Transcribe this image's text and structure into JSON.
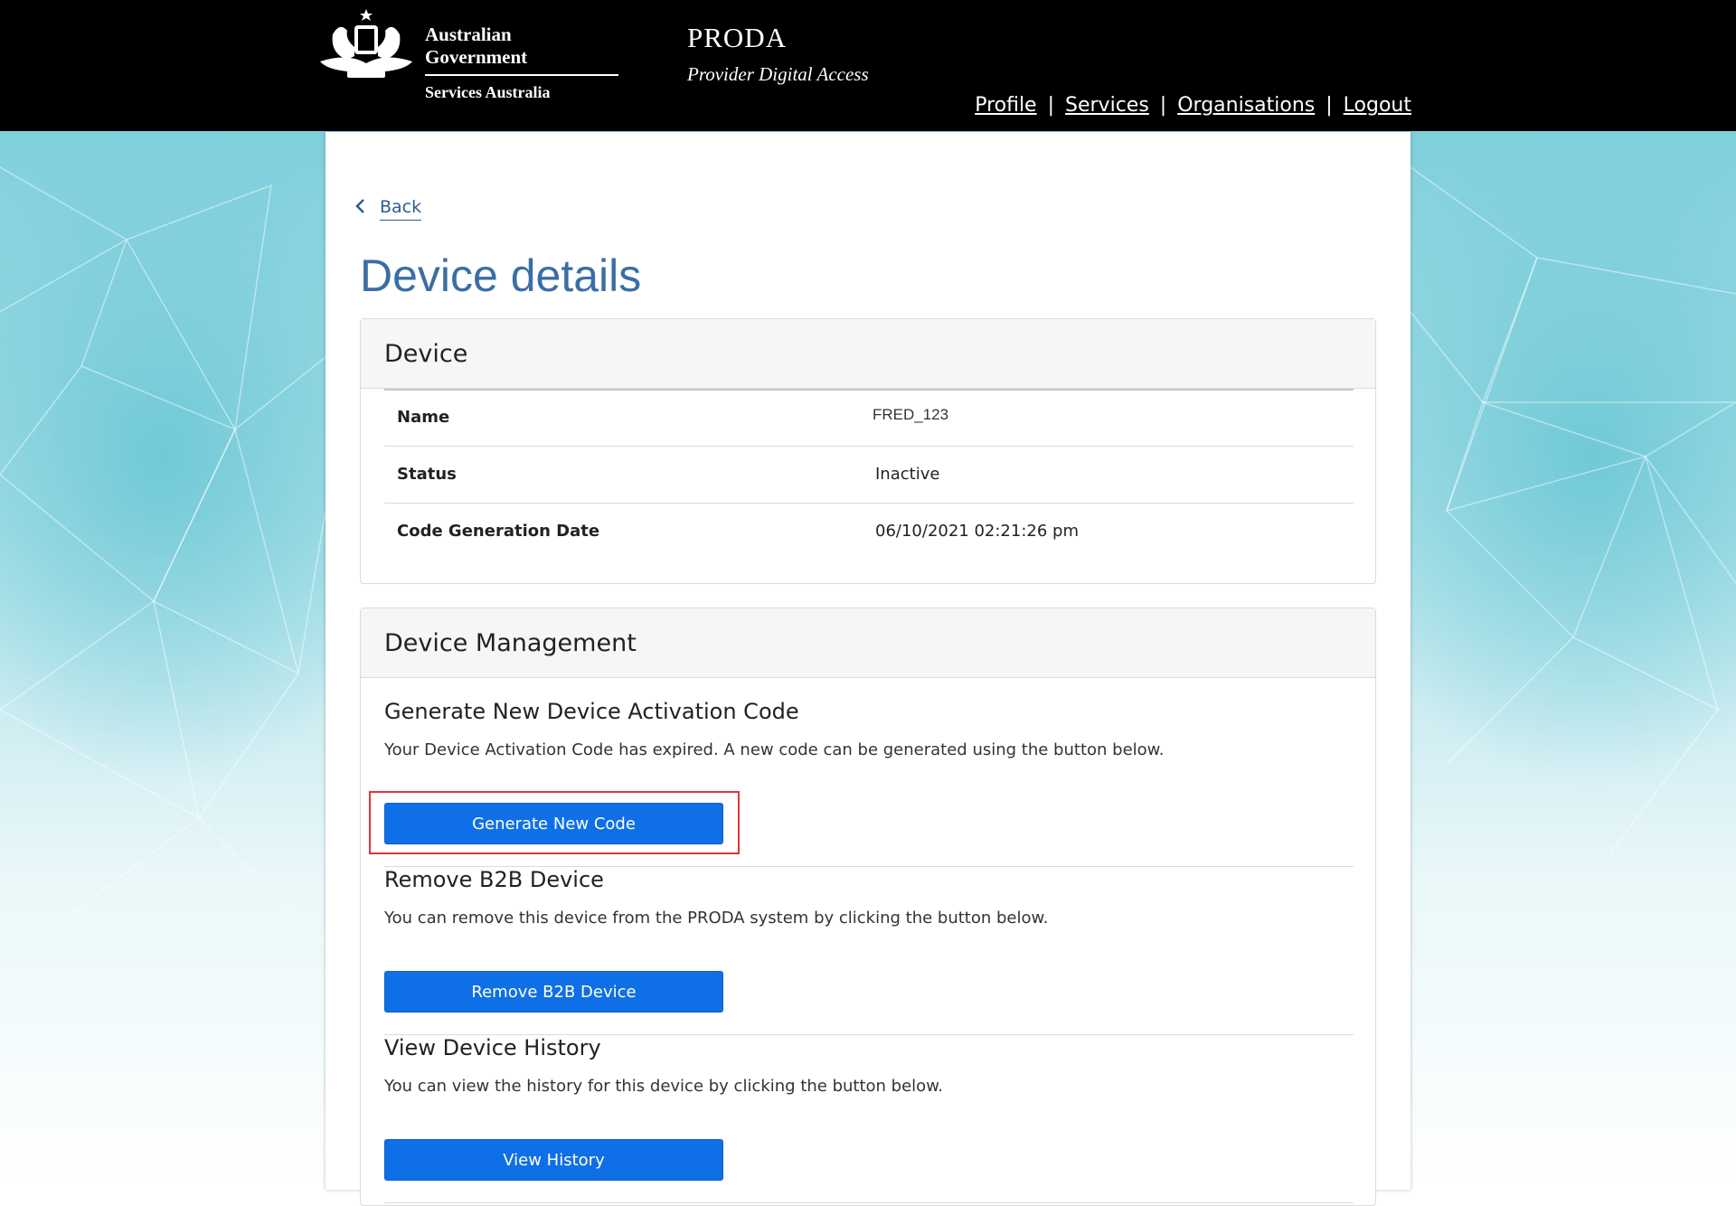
{
  "header": {
    "gov_line1": "Australian Government",
    "gov_line2": "Services Australia",
    "app_title": "PRODA",
    "app_subtitle": "Provider Digital Access",
    "nav": {
      "profile": "Profile",
      "services": "Services",
      "organisations": "Organisations",
      "logout": "Logout",
      "separator": "|"
    }
  },
  "page": {
    "back_label": "Back",
    "title": "Device details"
  },
  "device_card": {
    "heading": "Device",
    "rows": [
      {
        "label": "Name",
        "value": "FRED_123"
      },
      {
        "label": "Status",
        "value": "Inactive"
      },
      {
        "label": "Code Generation Date",
        "value": "06/10/2021 02:21:26 pm"
      }
    ]
  },
  "management_card": {
    "heading": "Device Management",
    "sections": [
      {
        "title": "Generate New Device Activation Code",
        "description": "Your Device Activation Code has expired. A new code can be generated using the button below.",
        "button": "Generate New Code"
      },
      {
        "title": "Remove B2B Device",
        "description": "You can remove this device from the PRODA system by clicking the button below.",
        "button": "Remove B2B Device"
      },
      {
        "title": "View Device History",
        "description": "You can view the history for this device by clicking the button below.",
        "button": "View History"
      }
    ]
  },
  "colors": {
    "header_bg": "#000000",
    "title_blue": "#3a6ea5",
    "button_blue": "#0f6fe6",
    "highlight_red": "#e0343a",
    "background_teal": "#7fcfdc"
  },
  "icons": {
    "crest": "australian-coat-of-arms-icon",
    "back": "chevron-left-icon"
  }
}
